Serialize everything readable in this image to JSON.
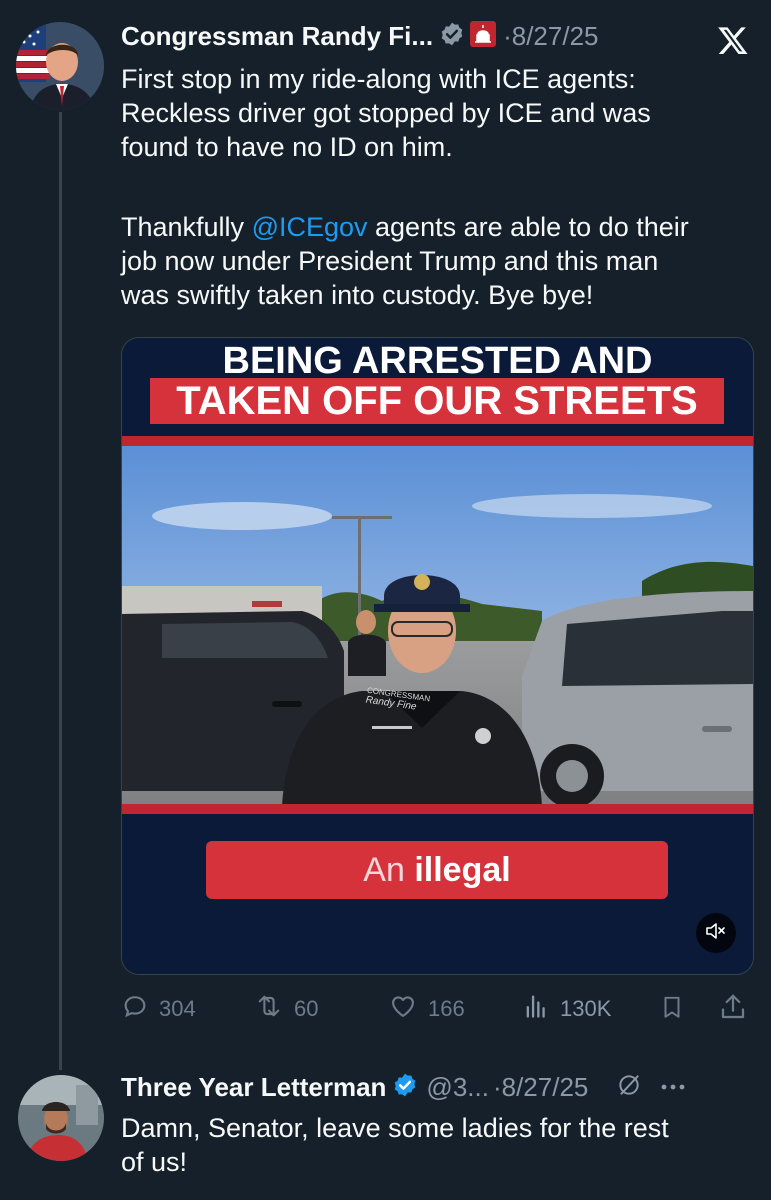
{
  "tweet": {
    "author_name": "Congressman Randy Fi...",
    "date": "8/27/25",
    "text_lines": [
      "First stop in my ride-along with ICE agents:",
      "Reckless driver got stopped by ICE and was",
      "found to have no ID on him."
    ],
    "para2_prefix": "Thankfully ",
    "mention": "@ICEgov",
    "para2_suffix": " agents are able to do their",
    "para2_lines": [
      "job now under President Trump and this man",
      "was swiftly taken into custody. Bye bye!"
    ],
    "media": {
      "headline_1": "BEING ARRESTED AND",
      "headline_2": "TAKEN OFF OUR STREETS",
      "caption_prefix": "An",
      "caption_word": "illegal",
      "cap_text": "CONGRESSMAN",
      "cap_signature": "Randy Fine"
    },
    "actions": {
      "replies": "304",
      "reposts": "60",
      "likes": "166",
      "views": "130K"
    }
  },
  "reply": {
    "author_name": "Three Year Letterman",
    "handle": "@3...",
    "date": "8/27/25",
    "text_line1": "Damn, Senator, leave some ladies for the rest",
    "text_line2": "of us!"
  },
  "colors": {
    "background": "#15202b",
    "link": "#1d9bf0",
    "verified": "#1d9bf0",
    "banner_red": "#d6323c",
    "banner_navy": "#0c1a3a",
    "muted_text": "#8b98a5"
  },
  "icons": [
    "verified-badge-icon",
    "capitol-affiliate-icon",
    "x-logo-icon",
    "reply-icon",
    "repost-icon",
    "like-icon",
    "views-icon",
    "bookmark-icon",
    "share-icon",
    "mute-icon",
    "grok-icon",
    "more-icon"
  ]
}
